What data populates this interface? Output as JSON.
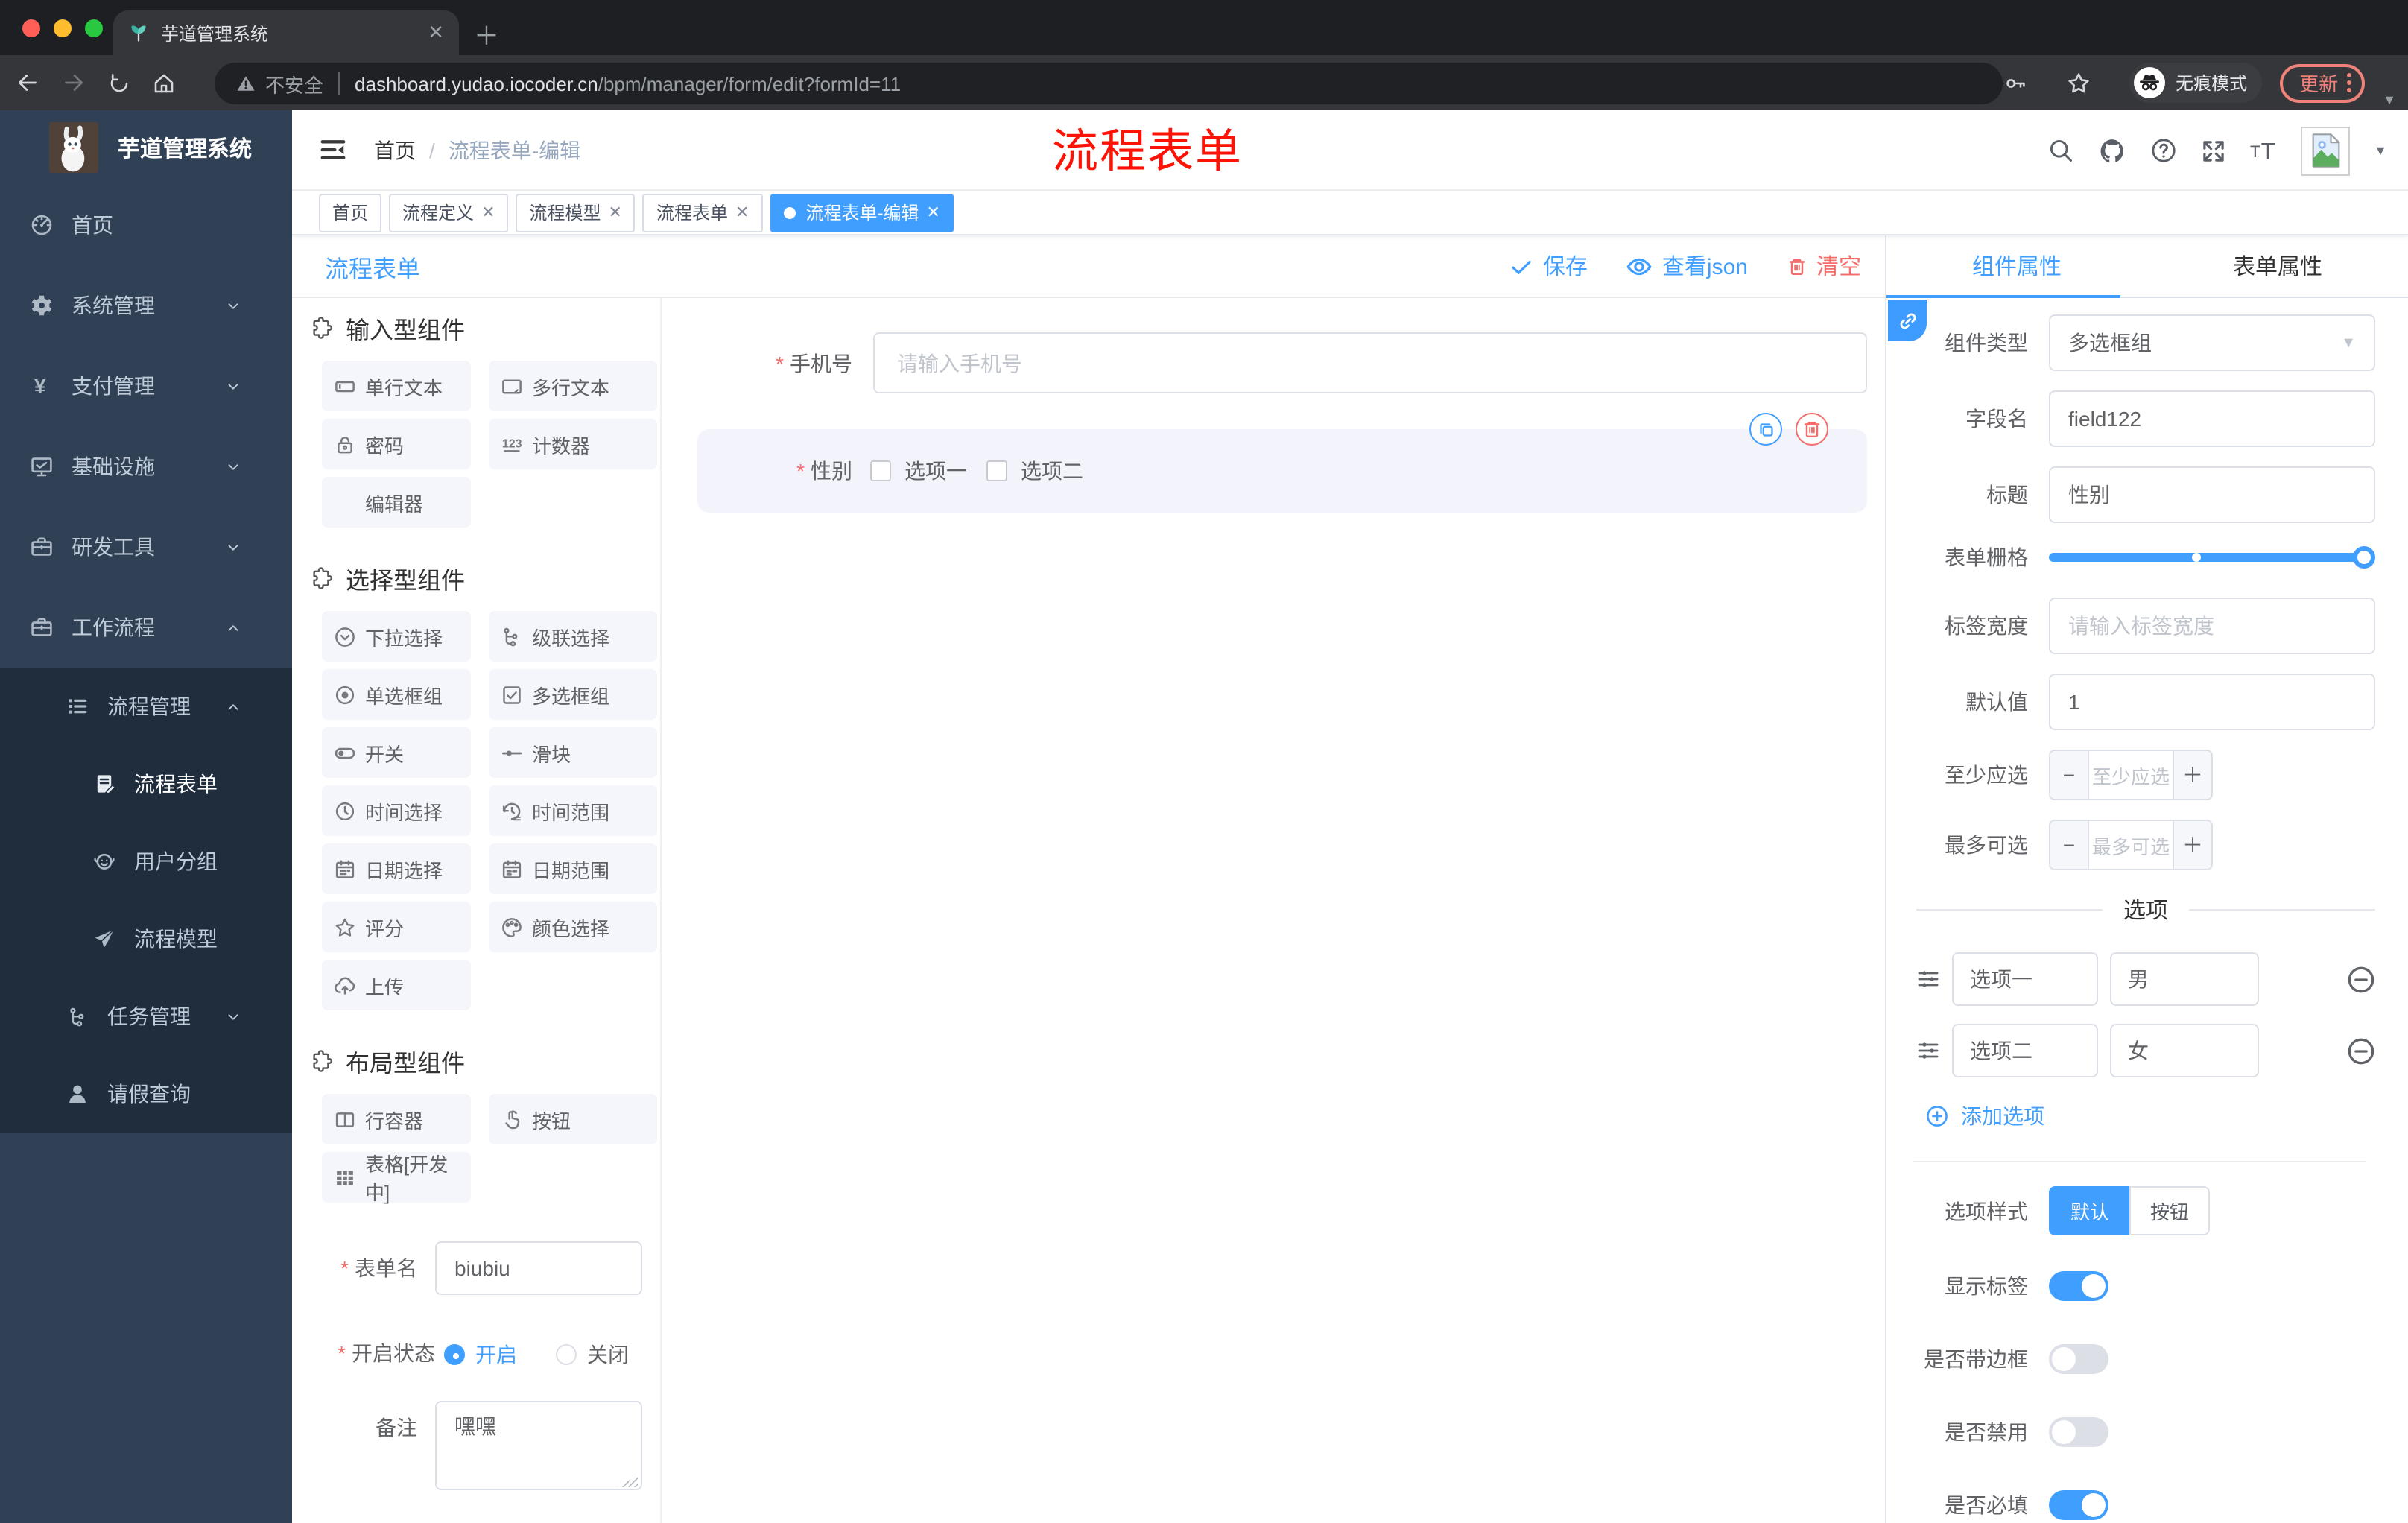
{
  "browser": {
    "tab_title": "芋道管理系统",
    "security_label": "不安全",
    "url_host": "dashboard.yudao.iocoder.cn",
    "url_path": "/bpm/manager/form/edit?formId=11",
    "incognito_label": "无痕模式",
    "update_label": "更新"
  },
  "sidebar": {
    "logo_title": "芋道管理系统",
    "menu": [
      {
        "label": "首页",
        "icon": "dashboard-icon",
        "level": 1,
        "chevron": "",
        "block": false,
        "active": false
      },
      {
        "label": "系统管理",
        "icon": "gear-icon",
        "level": 1,
        "chevron": "down",
        "block": false,
        "active": false
      },
      {
        "label": "支付管理",
        "icon": "yen-icon",
        "level": 1,
        "chevron": "down",
        "block": false,
        "active": false
      },
      {
        "label": "基础设施",
        "icon": "monitor-icon",
        "level": 1,
        "chevron": "down",
        "block": false,
        "active": false
      },
      {
        "label": "研发工具",
        "icon": "briefcase-icon",
        "level": 1,
        "chevron": "down",
        "block": false,
        "active": false
      },
      {
        "label": "工作流程",
        "icon": "briefcase-icon",
        "level": 1,
        "chevron": "up",
        "block": false,
        "active": false
      },
      {
        "label": "流程管理",
        "icon": "list-tree-icon",
        "level": 2,
        "chevron": "up",
        "block": true,
        "active": false
      },
      {
        "label": "流程表单",
        "icon": "doc-edit-icon",
        "level": 3,
        "chevron": "",
        "block": true,
        "active": true
      },
      {
        "label": "用户分组",
        "icon": "users-icon",
        "level": 3,
        "chevron": "",
        "block": true,
        "active": false
      },
      {
        "label": "流程模型",
        "icon": "send-icon",
        "level": 3,
        "chevron": "",
        "block": true,
        "active": false
      },
      {
        "label": "任务管理",
        "icon": "task-tree-icon",
        "level": 2,
        "chevron": "down",
        "block": true,
        "active": false
      },
      {
        "label": "请假查询",
        "icon": "person-icon",
        "level": 2,
        "chevron": "",
        "block": true,
        "active": false
      }
    ]
  },
  "header": {
    "breadcrumb_home": "首页",
    "breadcrumb_current": "流程表单-编辑",
    "annotation": "流程表单"
  },
  "tags": [
    {
      "label": "首页",
      "closable": false,
      "active": false
    },
    {
      "label": "流程定义",
      "closable": true,
      "active": false
    },
    {
      "label": "流程模型",
      "closable": true,
      "active": false
    },
    {
      "label": "流程表单",
      "closable": true,
      "active": false
    },
    {
      "label": "流程表单-编辑",
      "closable": true,
      "active": true
    }
  ],
  "designer": {
    "title": "流程表单",
    "save_label": "保存",
    "view_json_label": "查看json",
    "clear_label": "清空"
  },
  "palette": {
    "sections": [
      {
        "title": "输入型组件",
        "items": [
          {
            "label": "单行文本",
            "icon": "input-single-icon"
          },
          {
            "label": "多行文本",
            "icon": "input-multi-icon"
          },
          {
            "label": "密码",
            "icon": "lock-icon"
          },
          {
            "label": "计数器",
            "icon": "counter-icon"
          },
          {
            "label": "编辑器",
            "icon": ""
          }
        ]
      },
      {
        "title": "选择型组件",
        "items": [
          {
            "label": "下拉选择",
            "icon": "select-down-icon"
          },
          {
            "label": "级联选择",
            "icon": "cascade-icon"
          },
          {
            "label": "单选框组",
            "icon": "radio-icon"
          },
          {
            "label": "多选框组",
            "icon": "checkbox-icon"
          },
          {
            "label": "开关",
            "icon": "toggle-icon"
          },
          {
            "label": "滑块",
            "icon": "slider-icon"
          },
          {
            "label": "时间选择",
            "icon": "clock-icon"
          },
          {
            "label": "时间范围",
            "icon": "clock-range-icon"
          },
          {
            "label": "日期选择",
            "icon": "calendar-icon"
          },
          {
            "label": "日期范围",
            "icon": "calendar-range-icon"
          },
          {
            "label": "评分",
            "icon": "star-icon"
          },
          {
            "label": "颜色选择",
            "icon": "color-icon"
          },
          {
            "label": "上传",
            "icon": "upload-icon"
          }
        ]
      },
      {
        "title": "布局型组件",
        "items": [
          {
            "label": "行容器",
            "icon": "row-container-icon"
          },
          {
            "label": "按钮",
            "icon": "hand-icon"
          },
          {
            "label": "表格[开发中]",
            "icon": "table-icon"
          }
        ]
      }
    ],
    "form": {
      "name_label": "表单名",
      "name_value": "biubiu",
      "status_label": "开启状态",
      "status_on": "开启",
      "status_off": "关闭",
      "remark_label": "备注",
      "remark_value": "嘿嘿"
    }
  },
  "canvas": {
    "phone_label": "手机号",
    "phone_placeholder": "请输入手机号",
    "gender_label": "性别",
    "gender_options": [
      "选项一",
      "选项二"
    ]
  },
  "panel": {
    "tab_component": "组件属性",
    "tab_form": "表单属性",
    "type_label": "组件类型",
    "type_value": "多选框组",
    "field_label": "字段名",
    "field_value": "field122",
    "title_label": "标题",
    "title_value": "性别",
    "grid_label": "表单栅格",
    "width_label": "标签宽度",
    "width_placeholder": "请输入标签宽度",
    "default_label": "默认值",
    "default_value": "1",
    "min_label": "至少应选",
    "min_placeholder": "至少应选",
    "max_label": "最多可选",
    "max_placeholder": "最多可选",
    "options_title": "选项",
    "options": [
      {
        "label": "选项一",
        "value": "男"
      },
      {
        "label": "选项二",
        "value": "女"
      }
    ],
    "add_option_label": "添加选项",
    "style_label": "选项样式",
    "style_options": [
      "默认",
      "按钮"
    ],
    "style_active": "默认",
    "switches": [
      {
        "label": "显示标签",
        "on": true
      },
      {
        "label": "是否带边框",
        "on": false
      },
      {
        "label": "是否禁用",
        "on": false
      },
      {
        "label": "是否必填",
        "on": true
      }
    ]
  },
  "colors": {
    "accent": "#409eff",
    "danger": "#f56c6c",
    "sidebar_bg": "#304156",
    "submenu_bg": "#1f2d3d"
  }
}
